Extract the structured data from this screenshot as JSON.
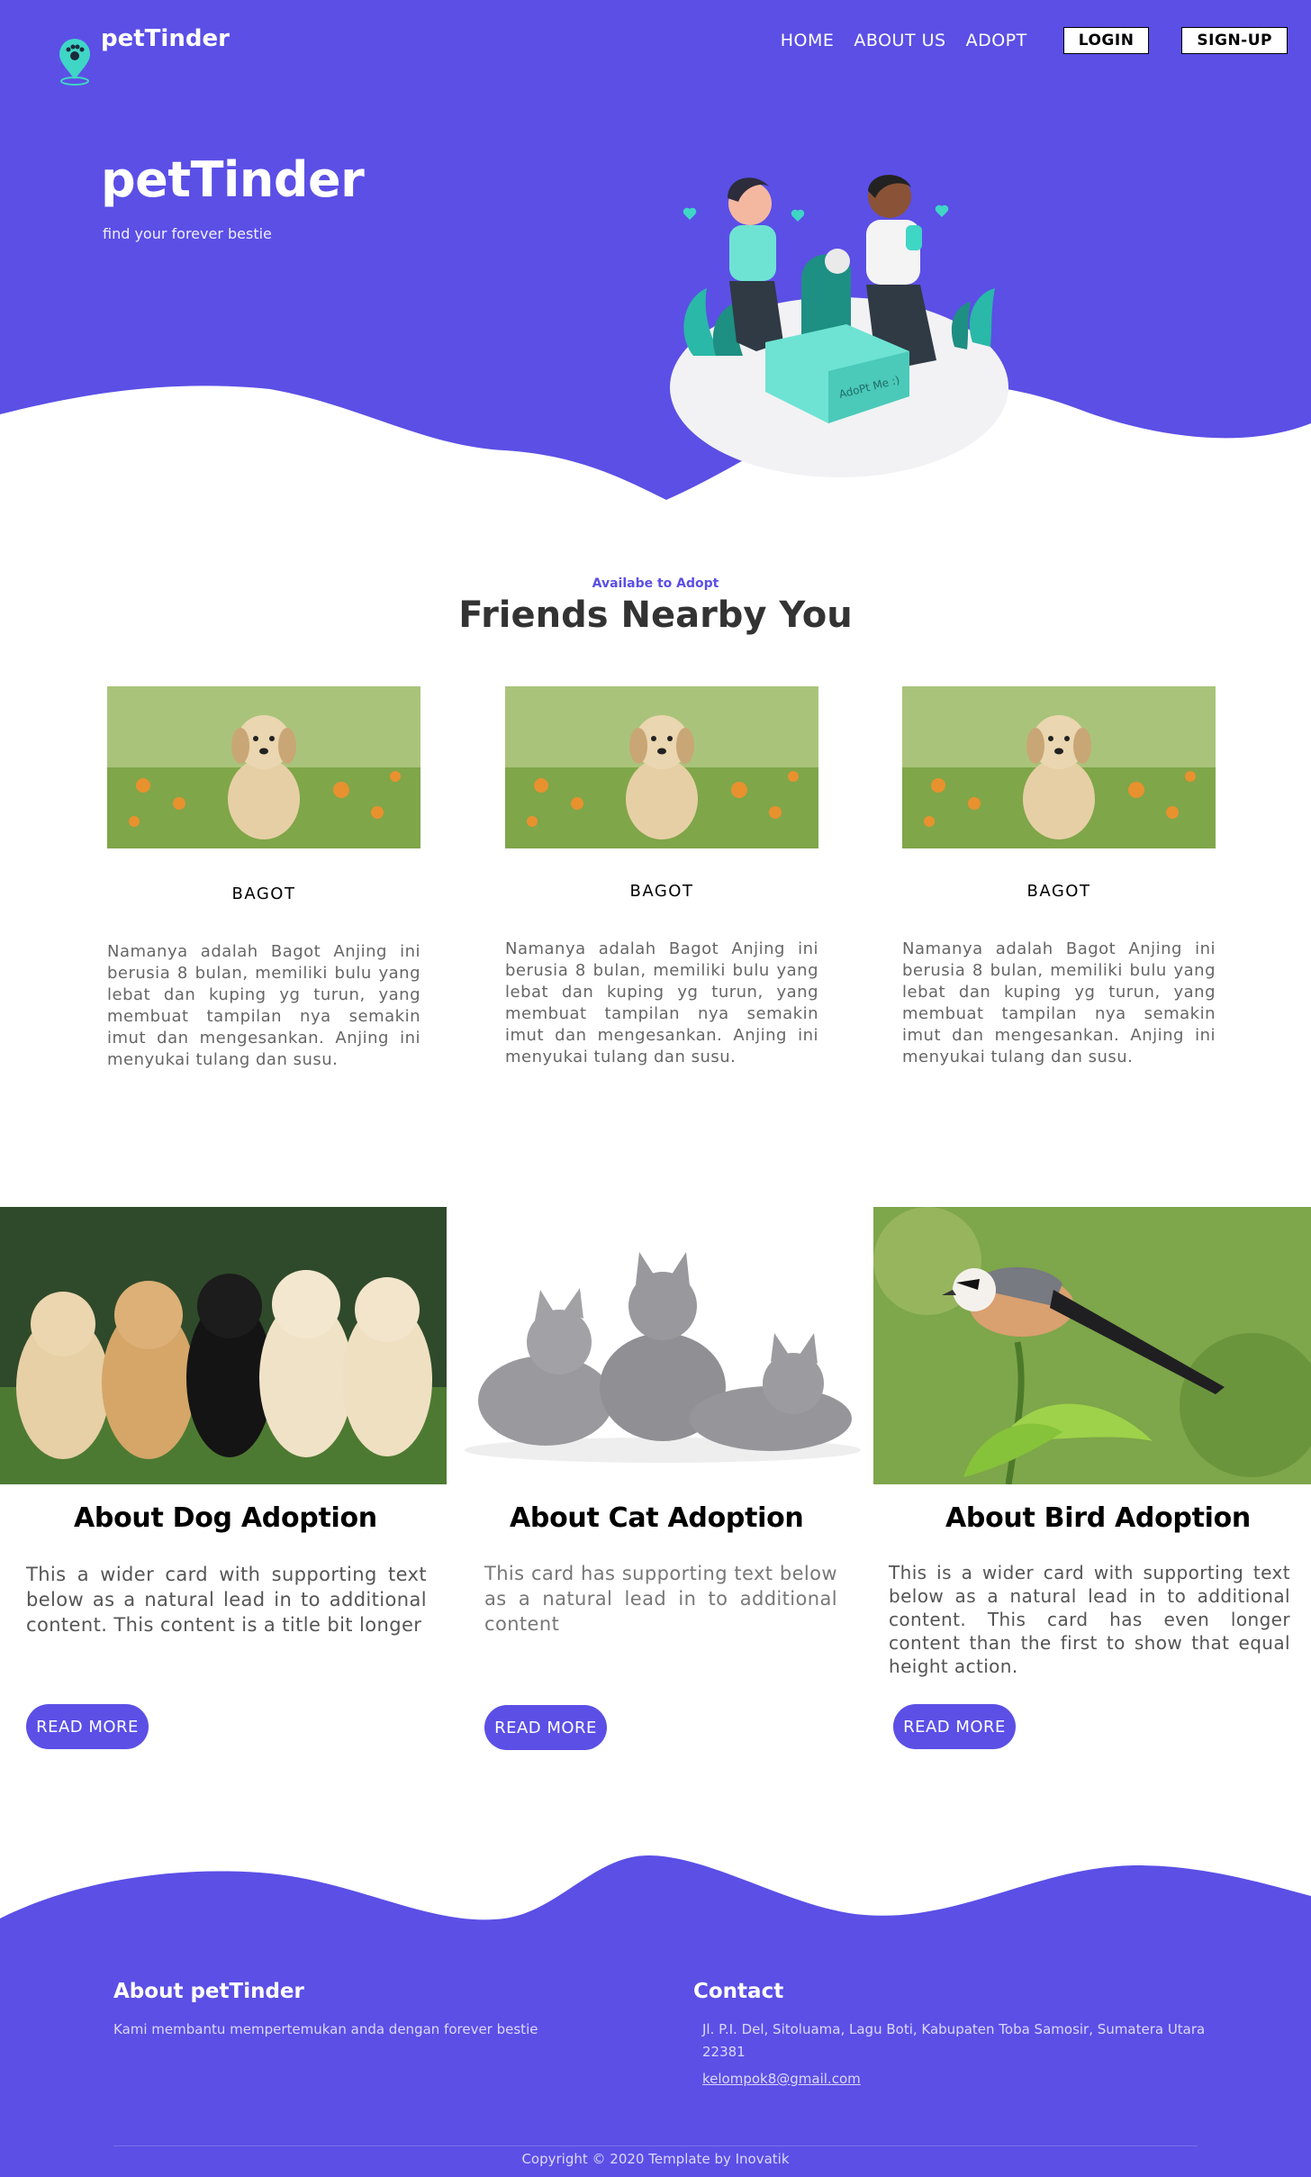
{
  "colors": {
    "brand": "#5b4fe6",
    "white": "#ffffff",
    "teal": "#3fd6c6"
  },
  "header": {
    "brand_name": "petTinder",
    "logo_icon": "paw-location-pin-icon",
    "nav": {
      "home": "HOME",
      "about": "ABOUT US",
      "adopt": "ADOPT",
      "login": "LOGIN",
      "signup": "SIGN-UP"
    }
  },
  "hero": {
    "title": "petTinder",
    "subtitle": "find your forever bestie",
    "illustration_box_text": "AdoPt Me :)"
  },
  "friends": {
    "eyebrow": "Availabe to Adopt",
    "title": "Friends Nearby You",
    "pets": [
      {
        "name": "BAGOT",
        "description": "Namanya adalah Bagot Anjing ini berusia 8 bulan, memiliki bulu yang lebat dan kuping yg turun, yang membuat tampilan nya semakin imut dan mengesankan. Anjing ini menyukai tulang dan susu."
      },
      {
        "name": "BAGOT",
        "description": "Namanya adalah Bagot Anjing ini berusia 8 bulan, memiliki bulu yang lebat dan kuping yg turun, yang membuat tampilan nya semakin imut dan mengesankan. Anjing ini menyukai tulang dan susu."
      },
      {
        "name": "BAGOT",
        "description": "Namanya adalah Bagot Anjing ini berusia 8 bulan, memiliki bulu yang lebat dan kuping yg turun, yang membuat tampilan nya semakin imut dan mengesankan. Anjing ini menyukai tulang dan susu."
      }
    ]
  },
  "adoption": [
    {
      "title": "About Dog Adoption",
      "text": "This a wider card with supporting text below as a natural lead in to additional content. This content is a title bit longer",
      "button": "READ MORE"
    },
    {
      "title": "About Cat Adoption",
      "text": "This card has supporting text below as a natural lead in to additional content",
      "button": "READ MORE"
    },
    {
      "title": "About Bird Adoption",
      "text": "This is a wider card with supporting text below as a natural lead in to additional content. This card has even longer content than the first to show that equal height action.",
      "button": "READ MORE"
    }
  ],
  "footer": {
    "about_heading": "About petTinder",
    "about_text": "Kami membantu mempertemukan anda dengan forever bestie",
    "contact_heading": "Contact",
    "address": "Jl. P.I. Del, Sitoluama, Lagu Boti, Kabupaten Toba Samosir, Sumatera Utara 22381",
    "email": "kelompok8@gmail.com",
    "copyright": "Copyright © 2020 Template by Inovatik"
  }
}
